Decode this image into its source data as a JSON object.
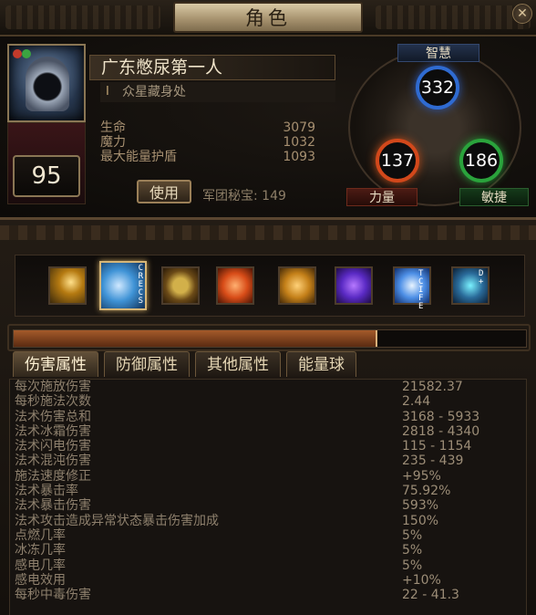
{
  "window": {
    "title": "角色",
    "close_glyph": "✕"
  },
  "character": {
    "name": "广东憋尿第一人",
    "guild": "众星藏身处",
    "level": "95",
    "vitals": [
      {
        "label": "生命",
        "value": "3079"
      },
      {
        "label": "魔力",
        "value": "1032"
      },
      {
        "label": "最大能量护盾",
        "value": "1093"
      }
    ],
    "use_label": "使用",
    "legion": "军团秘宝: 149"
  },
  "attributes": {
    "intelligence": {
      "label": "智慧",
      "value": "332",
      "color": "#2f6bd1"
    },
    "strength": {
      "label": "力量",
      "value": "137",
      "color": "#d2481b"
    },
    "dexterity": {
      "label": "敏捷",
      "value": "186",
      "color": "#2aa33c"
    }
  },
  "skills": [
    {
      "icon": "dagger-skill-icon",
      "tag": ""
    },
    {
      "icon": "ice-spell-skill-icon",
      "tag": "C\nR\nE\nC\nS"
    },
    {
      "icon": "rune-skill-icon",
      "tag": ""
    },
    {
      "icon": "dash-skill-icon",
      "tag": ""
    },
    {
      "icon": "cube-skill-icon",
      "tag": ""
    },
    {
      "icon": "fist-skill-icon",
      "tag": ""
    },
    {
      "icon": "lightning-skill-icon",
      "tag": "T C I F E"
    },
    {
      "icon": "aura-skill-icon",
      "tag": "D +"
    }
  ],
  "experience": {
    "fraction": 0.71
  },
  "tabs": [
    "伤害属性",
    "防御属性",
    "其他属性",
    "能量球"
  ],
  "stats": [
    {
      "name": "每次施放伤害",
      "value": "21582.37"
    },
    {
      "name": "每秒施法次数",
      "value": "2.44"
    },
    {
      "name": "法术伤害总和",
      "value": "3168 - 5933"
    },
    {
      "name": "法术冰霜伤害",
      "value": "2818 - 4340"
    },
    {
      "name": "法术闪电伤害",
      "value": "115 - 1154"
    },
    {
      "name": "法术混沌伤害",
      "value": "235 - 439"
    },
    {
      "name": "施法速度修正",
      "value": "+95%"
    },
    {
      "name": "法术暴击率",
      "value": "75.92%"
    },
    {
      "name": "法术暴击伤害",
      "value": "593%"
    },
    {
      "name": "法术攻击造成异常状态暴击伤害加成",
      "value": "150%"
    },
    {
      "name": "点燃几率",
      "value": "5%"
    },
    {
      "name": "冰冻几率",
      "value": "5%"
    },
    {
      "name": "感电几率",
      "value": "5%"
    },
    {
      "name": "感电效用",
      "value": "+10%"
    },
    {
      "name": "每秒中毒伤害",
      "value": "22 - 41.3"
    }
  ]
}
